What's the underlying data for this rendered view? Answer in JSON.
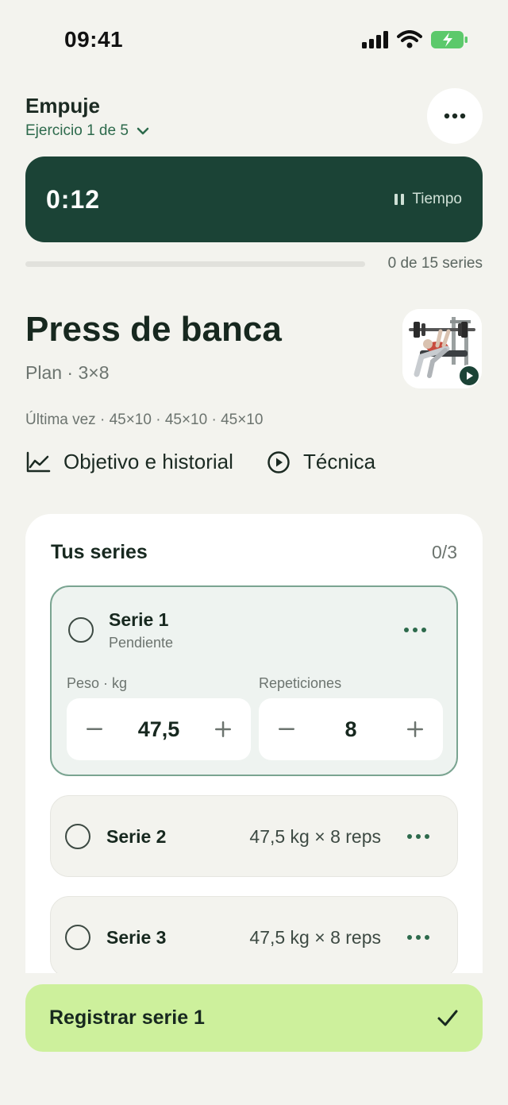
{
  "status_bar": {
    "time": "09:41"
  },
  "header": {
    "title": "Empuje",
    "subtitle": "Ejercicio 1 de 5"
  },
  "timer": {
    "value": "0:12",
    "pause_label": "Tiempo"
  },
  "progress": {
    "text": "0 de 15 series",
    "fraction": 0
  },
  "exercise": {
    "name": "Press de banca",
    "plan": "Plan · 3×8",
    "last_time": "Última vez · 45×10 · 45×10 · 45×10",
    "links": {
      "history": "Objetivo e historial",
      "technique": "Técnica"
    }
  },
  "sets": {
    "title": "Tus series",
    "count": "0/3",
    "active": {
      "name": "Serie 1",
      "status": "Pendiente",
      "weight_label": "Peso · kg",
      "weight_value": "47,5",
      "reps_label": "Repeticiones",
      "reps_value": "8"
    },
    "rows": [
      {
        "name": "Serie 2",
        "detail": "47,5 kg × 8 reps"
      },
      {
        "name": "Serie 3",
        "detail": "47,5 kg × 8 reps"
      }
    ]
  },
  "cta": {
    "label": "Registrar serie 1"
  },
  "colors": {
    "accent": "#2d6a4c",
    "dark": "#1b4336",
    "cta": "#cdf09c",
    "background": "#f3f3ee"
  }
}
